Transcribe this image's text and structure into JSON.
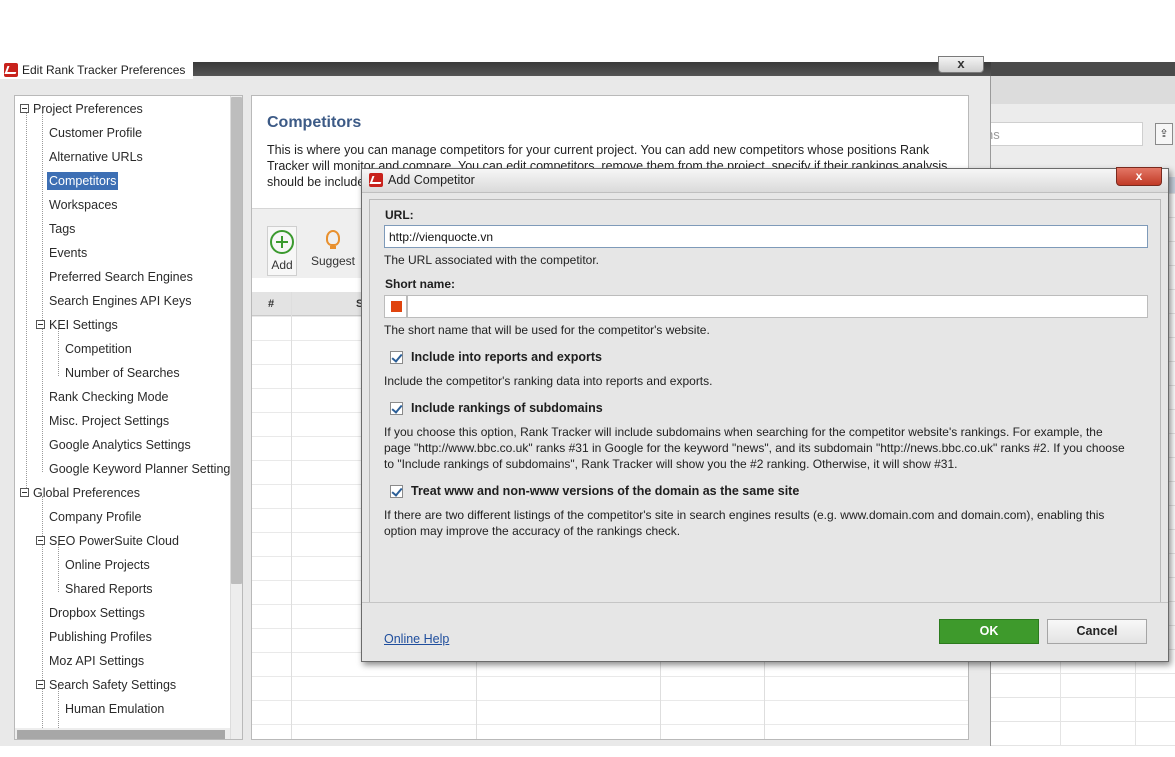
{
  "background_app": {
    "search_placeholder_fragment": "ns"
  },
  "prefs_window": {
    "title": "Edit Rank Tracker Preferences",
    "close_label": "x"
  },
  "tree": {
    "items": [
      {
        "label": "Project Preferences"
      },
      {
        "label": "Customer Profile"
      },
      {
        "label": "Alternative URLs"
      },
      {
        "label": "Competitors"
      },
      {
        "label": "Workspaces"
      },
      {
        "label": "Tags"
      },
      {
        "label": "Events"
      },
      {
        "label": "Preferred Search Engines"
      },
      {
        "label": "Search Engines API Keys"
      },
      {
        "label": "KEI Settings"
      },
      {
        "label": "Competition"
      },
      {
        "label": "Number of Searches"
      },
      {
        "label": "Rank Checking Mode"
      },
      {
        "label": "Misc. Project Settings"
      },
      {
        "label": "Google Analytics Settings"
      },
      {
        "label": "Google Keyword Planner Settings"
      },
      {
        "label": "Global Preferences"
      },
      {
        "label": "Company Profile"
      },
      {
        "label": "SEO PowerSuite Cloud"
      },
      {
        "label": "Online Projects"
      },
      {
        "label": "Shared Reports"
      },
      {
        "label": "Dropbox Settings"
      },
      {
        "label": "Publishing Profiles"
      },
      {
        "label": "Moz API Settings"
      },
      {
        "label": "Search Safety Settings"
      },
      {
        "label": "Human Emulation"
      }
    ]
  },
  "content": {
    "title": "Competitors",
    "description_line1": "This is where you can manage competitors for your current project. You can add new competitors whose positions Rank",
    "description_line2": "Tracker will monitor and compare. You can edit competitors, remove them from the project, specify if their rankings analysis",
    "description_line3": "should be included",
    "add_label": "Add",
    "suggest_label": "Suggest",
    "col_number": "#",
    "col_second_fragment": "S"
  },
  "dialog": {
    "title": "Add Competitor",
    "close_label": "x",
    "url_label": "URL:",
    "url_value": "http://vienquocte.vn",
    "url_hint": "The URL associated with the competitor.",
    "short_name_label": "Short name:",
    "short_name_value": "",
    "short_name_hint": "The short name that will be used for the competitor's website.",
    "opt_reports_label": "Include into reports and exports",
    "opt_reports_hint": "Include the competitor's ranking data into reports and exports.",
    "opt_subdomains_label": "Include rankings of subdomains",
    "opt_subdomains_hint_1": "If you choose this option, Rank Tracker will include subdomains when searching for the competitor website's rankings. For example, the",
    "opt_subdomains_hint_2": "page \"http://www.bbc.co.uk\" ranks #31 in Google for the keyword \"news\", and its subdomain \"http://news.bbc.co.uk\" ranks #2. If you choose",
    "opt_subdomains_hint_3": "to \"Include rankings of subdomains\", Rank Tracker will show you the #2 ranking. Otherwise, it will show #31.",
    "opt_www_label": "Treat www and non-www versions of the domain as the same site",
    "opt_www_hint_1": "If there are two different listings of the competitor's site in search engines results (e.g. www.domain.com and domain.com), enabling this",
    "opt_www_hint_2": "option may improve the accuracy of the rankings check.",
    "help_link": "Online Help",
    "ok_label": "OK",
    "cancel_label": "Cancel"
  },
  "colors": {
    "ok_green": "#3e9a2c",
    "selection_blue": "#3d6fb4",
    "close_red": "#c13a26",
    "swatch_orange": "#e0440e"
  }
}
